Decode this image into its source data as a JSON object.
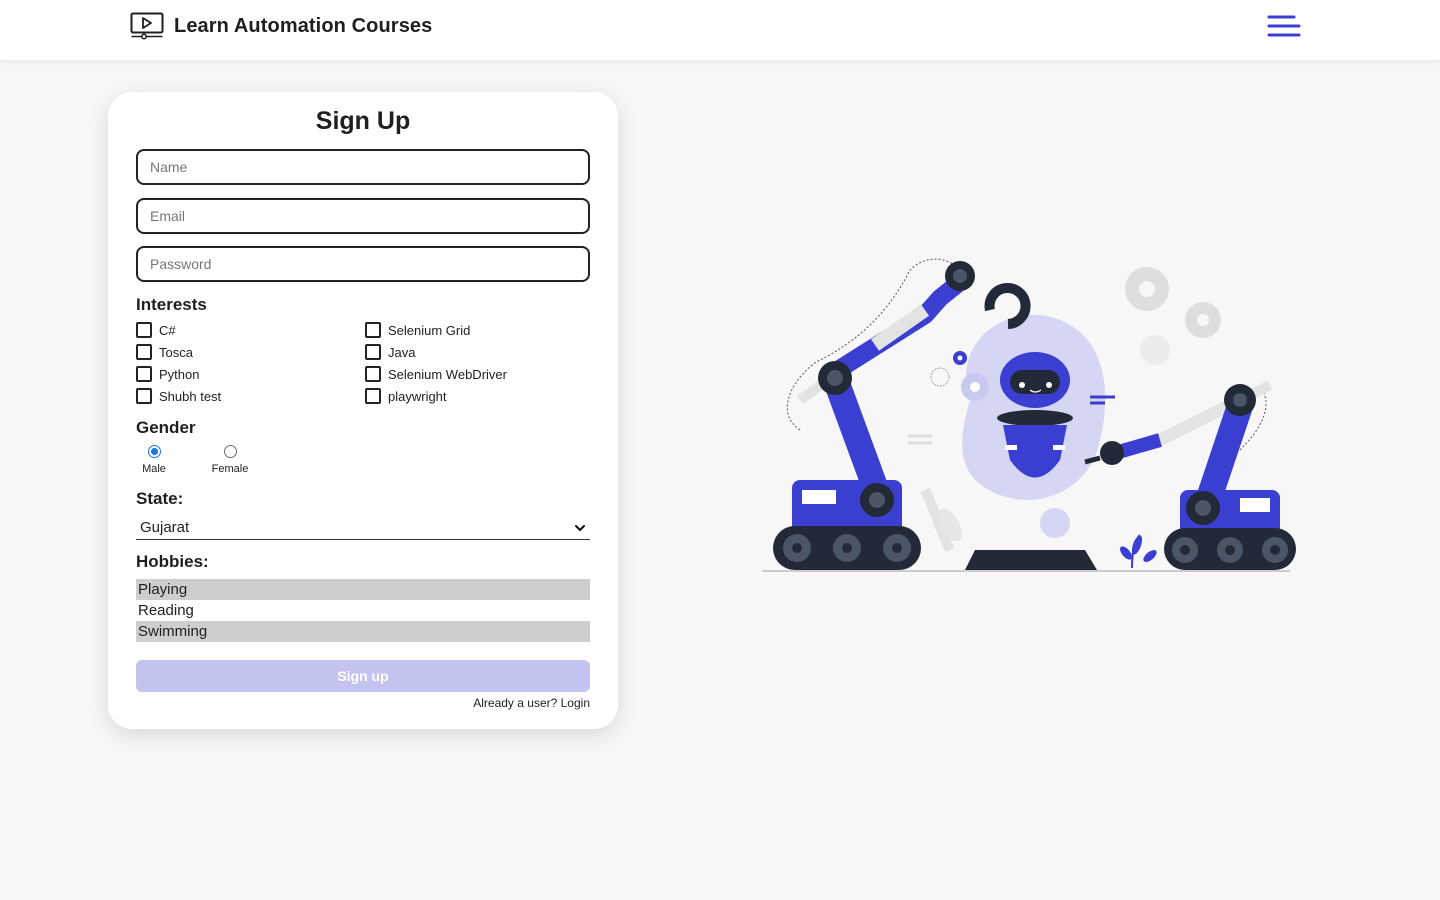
{
  "header": {
    "brand_title": "Learn Automation Courses",
    "brand_icon": "video-player-icon",
    "menu_icon": "hamburger-menu-icon"
  },
  "form": {
    "title": "Sign Up",
    "fields": {
      "name_placeholder": "Name",
      "email_placeholder": "Email",
      "password_placeholder": "Password"
    },
    "interests": {
      "label": "Interests",
      "options": [
        {
          "label": "C#",
          "checked": false
        },
        {
          "label": "Selenium Grid",
          "checked": false
        },
        {
          "label": "Tosca",
          "checked": false
        },
        {
          "label": "Java",
          "checked": false
        },
        {
          "label": "Python",
          "checked": false
        },
        {
          "label": "Selenium WebDriver",
          "checked": false
        },
        {
          "label": "Shubh test",
          "checked": false
        },
        {
          "label": "playwright",
          "checked": false
        }
      ]
    },
    "gender": {
      "label": "Gender",
      "options": [
        {
          "label": "Male",
          "checked": true
        },
        {
          "label": "Female",
          "checked": false
        }
      ]
    },
    "state": {
      "label": "State:",
      "selected": "Gujarat"
    },
    "hobbies": {
      "label": "Hobbies:",
      "options": [
        {
          "label": "Playing",
          "selected": true
        },
        {
          "label": "Reading",
          "selected": false
        },
        {
          "label": "Swimming",
          "selected": true
        }
      ]
    },
    "submit_label": "Sign up",
    "login_prompt": "Already a user?",
    "login_link": "Login"
  },
  "colors": {
    "accent": "#3b3fd1",
    "accent_light": "#c2c4ef",
    "background": "#f6f7f6",
    "radio_checked": "#1a73e8"
  },
  "illustration_icon": "robot-arms-illustration"
}
